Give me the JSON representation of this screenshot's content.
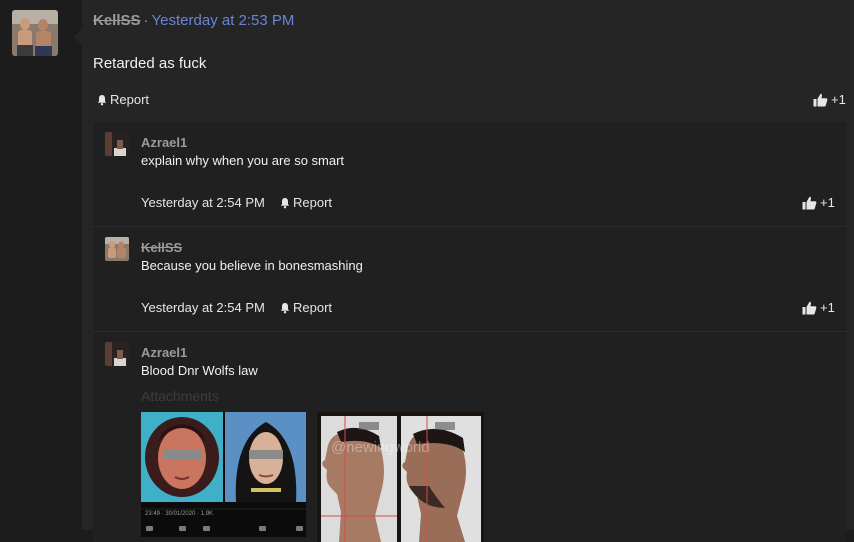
{
  "post": {
    "author": "KellSS",
    "separator": "·",
    "timestamp": "Yesterday at 2:53 PM",
    "body": "Retarded as fuck",
    "report_label": "Report",
    "reaction_count": "+1"
  },
  "comments": [
    {
      "author": "Azrael1",
      "text": "explain why when you are so smart",
      "timestamp": "Yesterday at 2:54 PM",
      "report_label": "Report",
      "reaction_count": "+1"
    },
    {
      "author": "KellSS",
      "text": "Because you believe in bonesmashing",
      "timestamp": "Yesterday at 2:54 PM",
      "report_label": "Report",
      "reaction_count": "+1"
    },
    {
      "author": "Azrael1",
      "text": "Blood Dnr Wolfs law",
      "attachments_label": "Attachments",
      "attachments": [
        {
          "name": "attachment-faces-comparison",
          "caption": "23:49 · 30/01/2020 · 1.9K"
        },
        {
          "name": "attachment-profile-comparison",
          "watermark": "@newingworld"
        }
      ]
    }
  ],
  "icons": {
    "report": "bell-icon",
    "reaction": "thumbs-up-icon"
  },
  "colors": {
    "background": "#1c1c1c",
    "panel": "#252525",
    "comment_panel": "#202020",
    "link": "#6b84d6",
    "muted": "#9b9b9b"
  }
}
